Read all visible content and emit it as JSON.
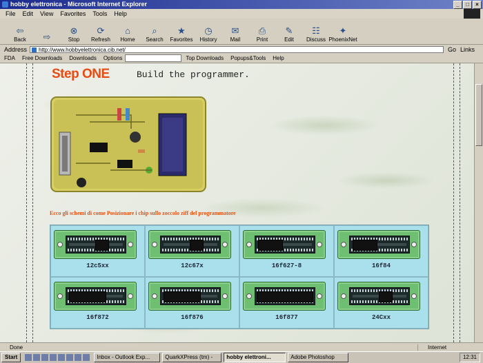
{
  "window": {
    "title": "hobby elettronica - Microsoft Internet Explorer"
  },
  "menu": [
    "File",
    "Edit",
    "View",
    "Favorites",
    "Tools",
    "Help"
  ],
  "toolbar": [
    {
      "label": "Back",
      "icon": "back-arrow-icon",
      "glyph": "⇦"
    },
    {
      "label": "",
      "icon": "forward-arrow-icon",
      "glyph": "⇨"
    },
    {
      "label": "Stop",
      "icon": "stop-icon",
      "glyph": "⊗"
    },
    {
      "label": "Refresh",
      "icon": "refresh-icon",
      "glyph": "⟳"
    },
    {
      "label": "Home",
      "icon": "home-icon",
      "glyph": "⌂"
    },
    {
      "label": "Search",
      "icon": "search-icon",
      "glyph": "⌕"
    },
    {
      "label": "Favorites",
      "icon": "favorites-icon",
      "glyph": "★"
    },
    {
      "label": "History",
      "icon": "history-icon",
      "glyph": "◷"
    },
    {
      "label": "Mail",
      "icon": "mail-icon",
      "glyph": "✉"
    },
    {
      "label": "Print",
      "icon": "print-icon",
      "glyph": "⎙"
    },
    {
      "label": "Edit",
      "icon": "edit-icon",
      "glyph": "✎"
    },
    {
      "label": "Discuss",
      "icon": "discuss-icon",
      "glyph": "☷"
    },
    {
      "label": "PhoenixNet",
      "icon": "phoenixnet-icon",
      "glyph": "✦"
    }
  ],
  "address": {
    "label": "Address",
    "url": "http://www.hobbyelettronica.cib.net/",
    "go": "Go",
    "links": "Links"
  },
  "links_bar": [
    "FDA",
    "Free Downloads",
    "Downloads",
    "Options",
    "Top Downloads",
    "Popups&Tools",
    "Help"
  ],
  "page": {
    "step_title": "Step ONE",
    "step_subtitle": "Build the programmer.",
    "caption": "Ecco gli schemi di come Posizionare i chip sullo zoccolo ziff del programmatore",
    "chips": [
      {
        "label": "12c5xx",
        "chip_pos": "mid",
        "size": "small"
      },
      {
        "label": "12c67x",
        "chip_pos": "mid",
        "size": "small"
      },
      {
        "label": "16f627-8",
        "chip_pos": "left",
        "size": "medium"
      },
      {
        "label": "16f84",
        "chip_pos": "left",
        "size": "medium"
      },
      {
        "label": "16f872",
        "chip_pos": "left",
        "size": "large"
      },
      {
        "label": "16f876",
        "chip_pos": "left",
        "size": "large"
      },
      {
        "label": "16f877",
        "chip_pos": "full",
        "size": "xlarge"
      },
      {
        "label": "24Cxx",
        "chip_pos": "mid",
        "size": "small"
      }
    ]
  },
  "status": {
    "text": "Done",
    "zone": "Internet"
  },
  "taskbar": {
    "start": "Start",
    "tasks": [
      "Inbox - Outlook Exp...",
      "QuarkXPress (tm) -",
      "hobby elettroni...",
      "Adobe Photoshop"
    ],
    "clock": "12:31"
  }
}
